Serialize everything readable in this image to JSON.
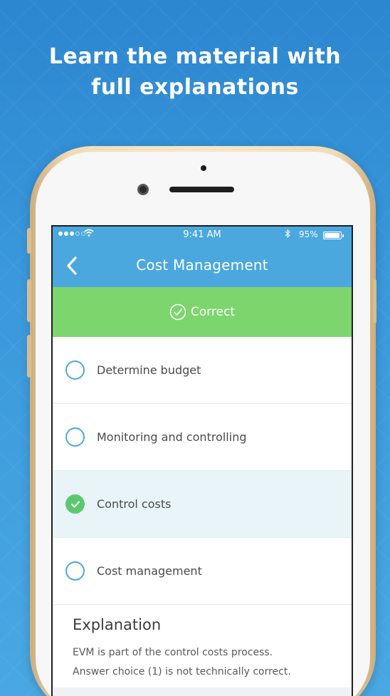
{
  "headline": {
    "line1": "Learn the material with",
    "line2": "full explanations"
  },
  "status_bar": {
    "time": "9:41 AM",
    "battery": "95%",
    "battery_level": 0.95
  },
  "nav": {
    "title": "Cost Management"
  },
  "result": {
    "label": "Correct"
  },
  "answers": [
    {
      "label": "Determine budget",
      "selected": false
    },
    {
      "label": "Monitoring and controlling",
      "selected": false
    },
    {
      "label": "Control costs",
      "selected": true
    },
    {
      "label": "Cost management",
      "selected": false
    }
  ],
  "explanation": {
    "title": "Explanation",
    "line1": "EVM is part of the control costs process.",
    "line2": "Answer choice (1) is not technically correct."
  },
  "colors": {
    "background": "#3a98db",
    "nav": "#4aa8de",
    "correct": "#7dd56e",
    "selected_check": "#5cc86e",
    "selected_row": "#e9f4f9",
    "phone_gold": "#f1dcb7"
  },
  "icons": [
    "back-chevron-icon",
    "check-circle-icon",
    "radio-icon",
    "wifi-icon",
    "bluetooth-icon",
    "battery-icon",
    "signal-icon"
  ]
}
